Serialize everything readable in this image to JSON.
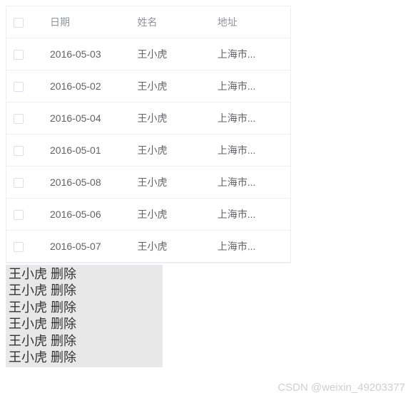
{
  "table": {
    "headers": {
      "date": "日期",
      "name": "姓名",
      "address": "地址"
    },
    "rows": [
      {
        "date": "2016-05-03",
        "name": "王小虎",
        "address": "上海市..."
      },
      {
        "date": "2016-05-02",
        "name": "王小虎",
        "address": "上海市..."
      },
      {
        "date": "2016-05-04",
        "name": "王小虎",
        "address": "上海市..."
      },
      {
        "date": "2016-05-01",
        "name": "王小虎",
        "address": "上海市..."
      },
      {
        "date": "2016-05-08",
        "name": "王小虎",
        "address": "上海市..."
      },
      {
        "date": "2016-05-06",
        "name": "王小虎",
        "address": "上海市..."
      },
      {
        "date": "2016-05-07",
        "name": "王小虎",
        "address": "上海市..."
      }
    ]
  },
  "list": {
    "items": [
      {
        "name": "王小虎",
        "action": "删除"
      },
      {
        "name": "王小虎",
        "action": "删除"
      },
      {
        "name": "王小虎",
        "action": "删除"
      },
      {
        "name": "王小虎",
        "action": "删除"
      },
      {
        "name": "王小虎",
        "action": "删除"
      },
      {
        "name": "王小虎",
        "action": "删除"
      }
    ]
  },
  "watermark": "CSDN @weixin_49203377"
}
